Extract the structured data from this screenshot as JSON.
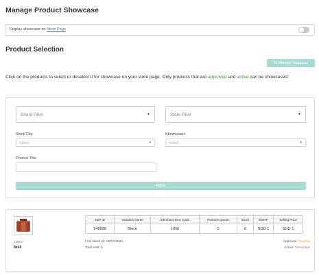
{
  "page_title": "Manage Product Showcase",
  "showcase": {
    "label_prefix": "Display showcase on",
    "link_text": "Store Page",
    "toggle_on": false
  },
  "section_title": "Product Selection",
  "manage_sequence_label": "Manage Sequence",
  "description": {
    "part1": "Click on the products to select or deselect it for showcase on your store page. Only products that are",
    "approved": "approved",
    "and": "and",
    "active": "active",
    "part2": "can be showcased:"
  },
  "filters": {
    "brand_placeholder": "Brand Filter",
    "state_placeholder": "State Filter",
    "stock_city_label": "Stock City",
    "stock_city_value": "Select",
    "showcased_label": "Showcased",
    "showcased_value": "Select",
    "product_title_label": "Product Title",
    "product_title_value": "",
    "filter_button": "Filter"
  },
  "product": {
    "sku": "148km",
    "name": "test",
    "table_headers": [
      "S&P ID",
      "Variation Name",
      "Merchant SKU Code",
      "Restock Queue",
      "Stock",
      "MSRP",
      "Selling Price"
    ],
    "table_row": [
      "148898",
      "Black",
      "1090",
      "0",
      "6",
      "SGD 1",
      "SGD 1"
    ],
    "first_listed": "First listed on: 09/07/2021",
    "total_sold": "Total sold: 0",
    "approval_label": "Approval:",
    "approval_value": "Pending",
    "active_label": "Active:",
    "active_value": "Not Active"
  },
  "colors": {
    "accent": "#a6dcd3",
    "link": "#2a7cc7",
    "approved": "#3a9d3a",
    "pending": "#e8a33a",
    "not_active": "#e04a3a"
  }
}
